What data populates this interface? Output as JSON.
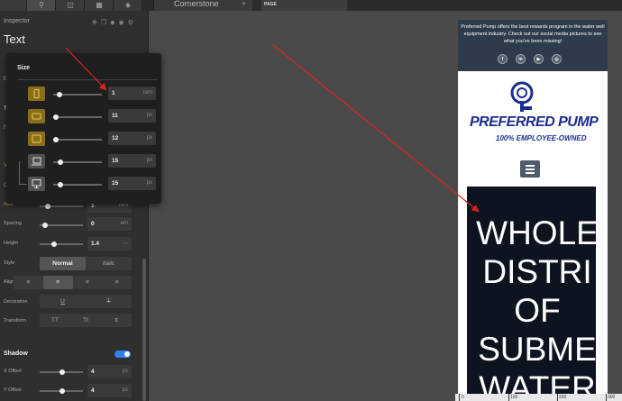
{
  "topbar": {
    "document_tab": "Cornerstone",
    "page_tab": "PAGE"
  },
  "inspector": {
    "title": "Inspector",
    "element_type": "Text",
    "rows": [
      {
        "label": "Size",
        "value": "1",
        "unit": "rem"
      },
      {
        "label": "Spacing",
        "value": "0",
        "unit": "em"
      },
      {
        "label": "Height",
        "value": "1.4",
        "unit": "⋯"
      },
      {
        "label": "Style"
      },
      {
        "label": "Align"
      },
      {
        "label": "Decoration"
      },
      {
        "label": "Transform"
      }
    ],
    "style_options": [
      "Normal",
      "Italic"
    ],
    "transform_options": [
      "TT",
      "Tt",
      "tt"
    ],
    "shadow": {
      "title": "Shadow",
      "enabled": true,
      "x_label": "X Offset",
      "x_value": "4",
      "x_unit": "px",
      "y_label": "Y Offset",
      "y_value": "4",
      "y_unit": "px"
    },
    "side_letters": [
      "E",
      "T",
      "F",
      "V",
      "C"
    ]
  },
  "popover": {
    "title": "Size",
    "breakpoints": [
      {
        "name": "mobile",
        "value": "1",
        "unit": "rem",
        "icon": "phone-icon"
      },
      {
        "name": "small-tablet",
        "value": "11",
        "unit": "px",
        "icon": "tablet-landscape-icon"
      },
      {
        "name": "tablet",
        "value": "12",
        "unit": "px",
        "icon": "tablet-icon"
      },
      {
        "name": "laptop",
        "value": "15",
        "unit": "px",
        "icon": "laptop-icon"
      },
      {
        "name": "desktop",
        "value": "15",
        "unit": "px",
        "icon": "monitor-icon"
      }
    ]
  },
  "preview": {
    "promo_text": "Preferred Pump offers the best rewards program in the water well equipment industry. Check out our social media pictures to see what you've been missing!",
    "social_icons": [
      "f",
      "in",
      "▶",
      "◎"
    ],
    "logo_name": "PREFERRED PUMP",
    "logo_tagline": "100% EMPLOYEE-OWNED",
    "hero_lines": [
      "WHOLE",
      "DISTRI",
      "OF",
      "SUBME",
      "WATER"
    ]
  },
  "ruler": {
    "labels": [
      "0",
      "100",
      "200",
      "300"
    ]
  },
  "colors": {
    "accent": "#d4a72c",
    "toggle": "#2f80ed",
    "arrow": "#e02020",
    "brand_blue": "#1b2d8f"
  }
}
